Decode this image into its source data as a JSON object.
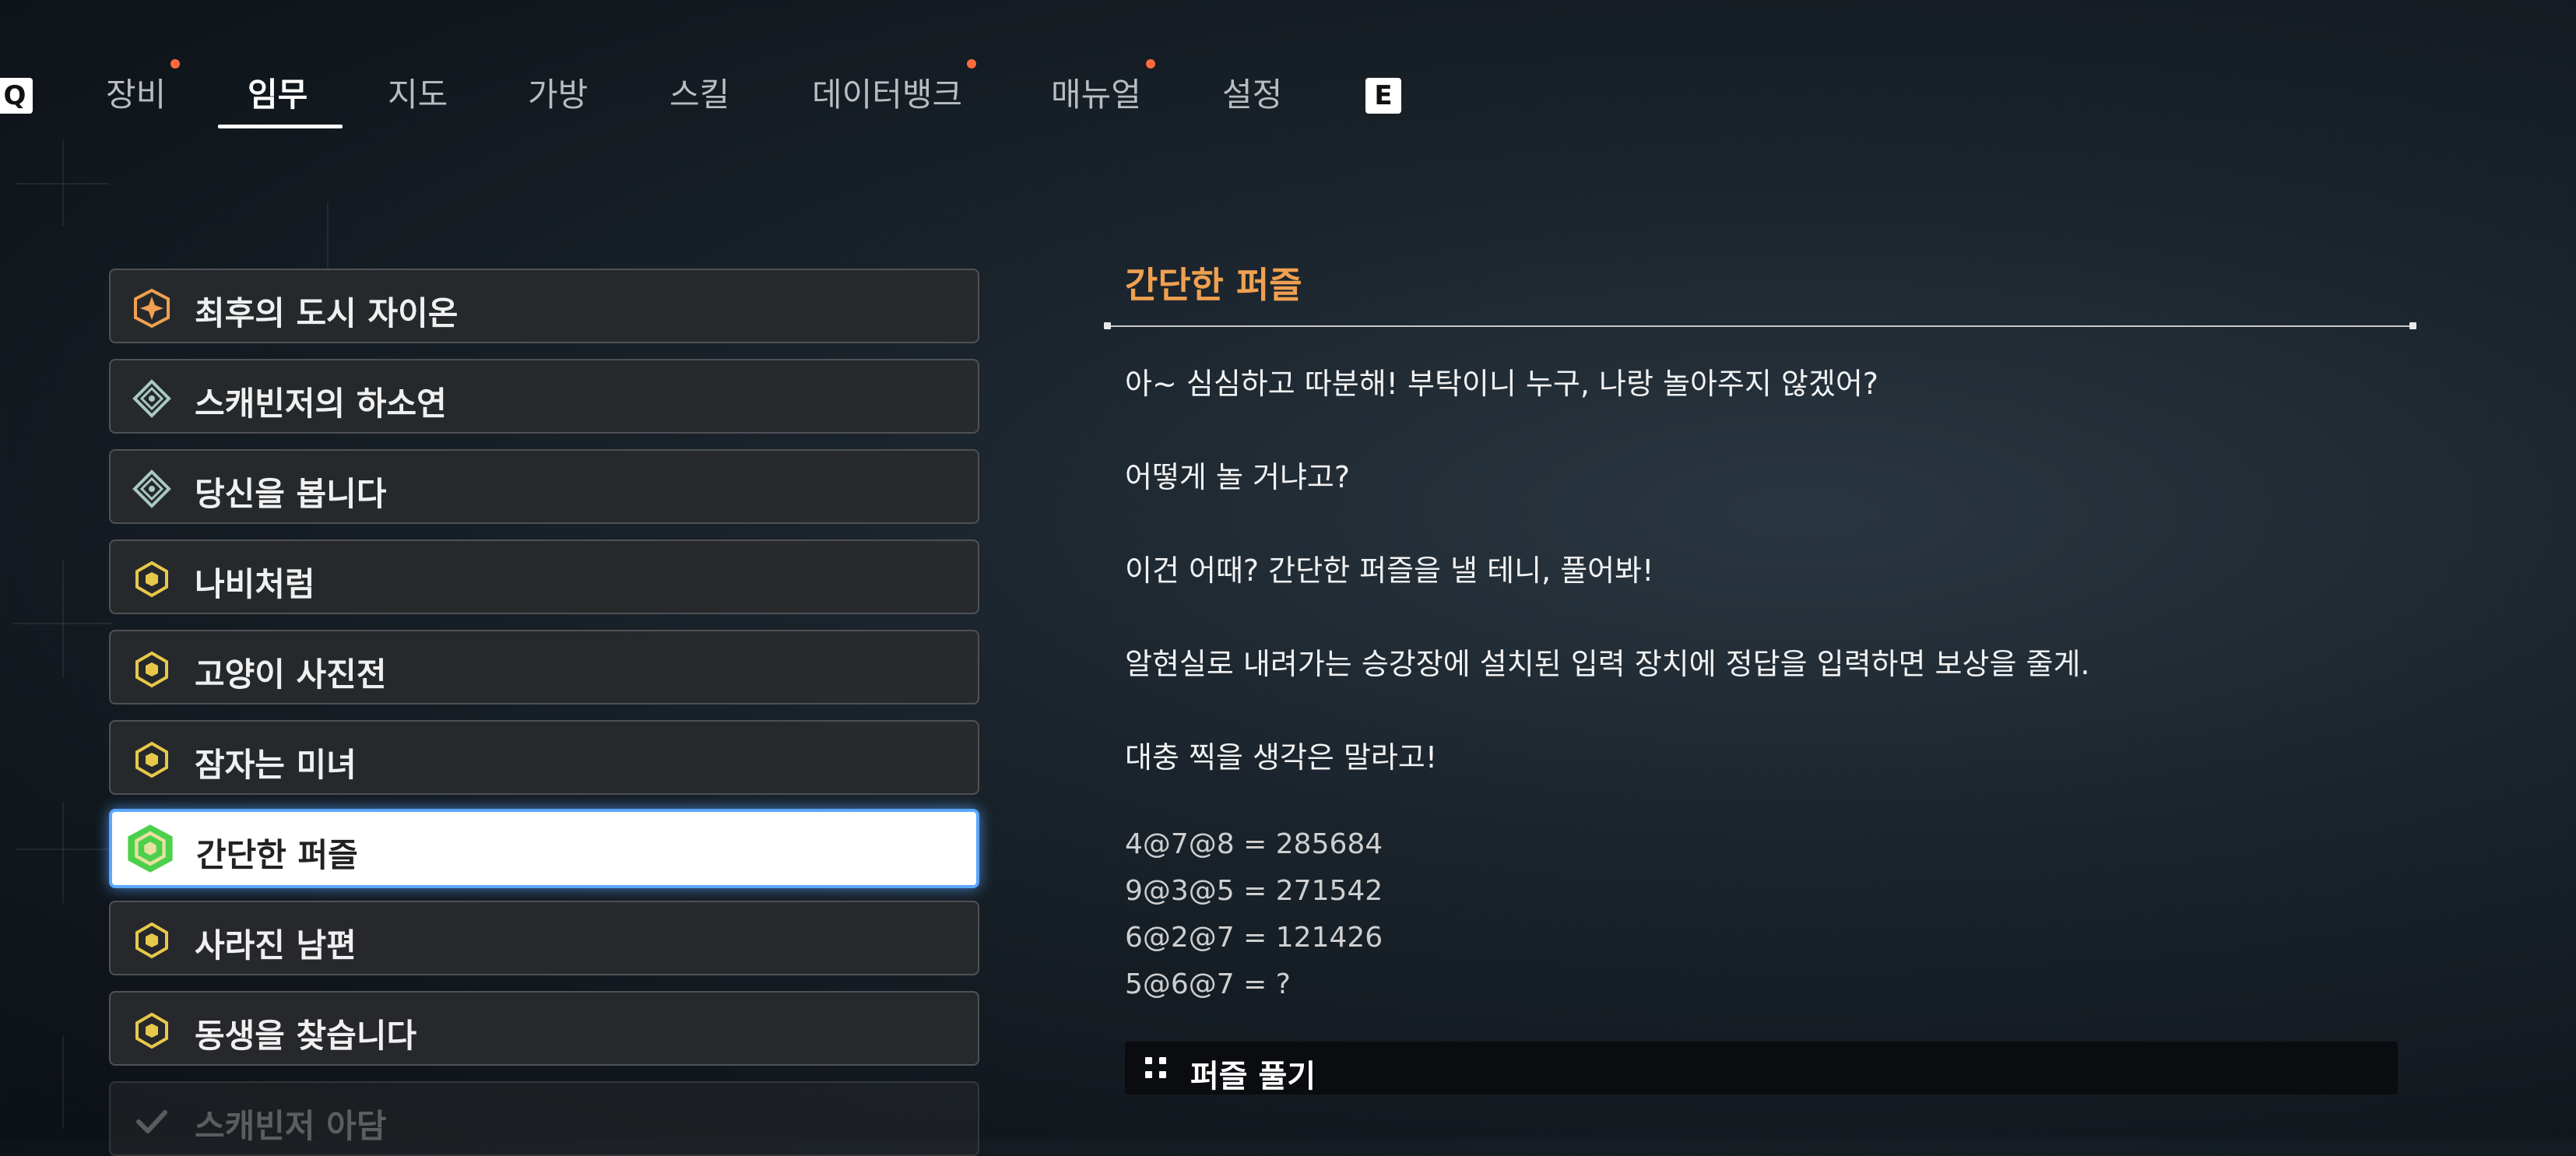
{
  "nav": {
    "prev_key": "Q",
    "next_key": "E",
    "tabs": [
      {
        "label": "장비",
        "notify": true
      },
      {
        "label": "임무",
        "notify": false,
        "active": true
      },
      {
        "label": "지도",
        "notify": false
      },
      {
        "label": "가방",
        "notify": false
      },
      {
        "label": "스킬",
        "notify": false
      },
      {
        "label": "데이터뱅크",
        "notify": true
      },
      {
        "label": "매뉴얼",
        "notify": true
      },
      {
        "label": "설정",
        "notify": false
      }
    ]
  },
  "quests": [
    {
      "label": "최후의 도시 자이온",
      "icon": "main-quest-star-icon",
      "color": "#f0a050"
    },
    {
      "label": "스캐빈저의 하소연",
      "icon": "emblem-icon",
      "color": "#a8c8c0"
    },
    {
      "label": "당신을 봅니다",
      "icon": "emblem-icon",
      "color": "#a8c8c0"
    },
    {
      "label": "나비처럼",
      "icon": "hexagon-icon",
      "color": "#e8c84a"
    },
    {
      "label": "고양이 사진전",
      "icon": "hexagon-icon",
      "color": "#e8c84a"
    },
    {
      "label": "잠자는 미녀",
      "icon": "hexagon-icon",
      "color": "#e8c84a"
    },
    {
      "label": "간단한 퍼즐",
      "icon": "hexagon-icon",
      "color": "#e8c84a",
      "selected": true
    },
    {
      "label": "사라진 남편",
      "icon": "hexagon-icon",
      "color": "#e8c84a"
    },
    {
      "label": "동생을 찾습니다",
      "icon": "hexagon-icon",
      "color": "#e8c84a"
    },
    {
      "label": "스캐빈저 아담",
      "icon": "checkmark-icon",
      "color": "#9a9a9a",
      "done": true
    }
  ],
  "detail": {
    "title": "간단한 퍼즐",
    "dialog": [
      "아~ 심심하고 따분해! 부탁이니 누구, 나랑 놀아주지 않겠어?",
      "어떻게 놀 거냐고?",
      "이건 어때? 간단한 퍼즐을 낼 테니, 풀어봐!",
      "알현실로 내려가는 승강장에 설치된 입력 장치에 정답을 입력하면 보상을 줄게.",
      "대충 찍을 생각은 말라고!"
    ],
    "equations": [
      "4@7@8 = 285684",
      "9@3@5 = 271542",
      "6@2@7 = 121426",
      "5@6@7 = ?"
    ],
    "solve_label": "퍼즐 풀기"
  },
  "colors": {
    "accent_orange": "#f0a050",
    "notify_dot": "#ff6a3d",
    "selected_border": "#5aa7ff",
    "selected_icon": "#4cd04c"
  }
}
